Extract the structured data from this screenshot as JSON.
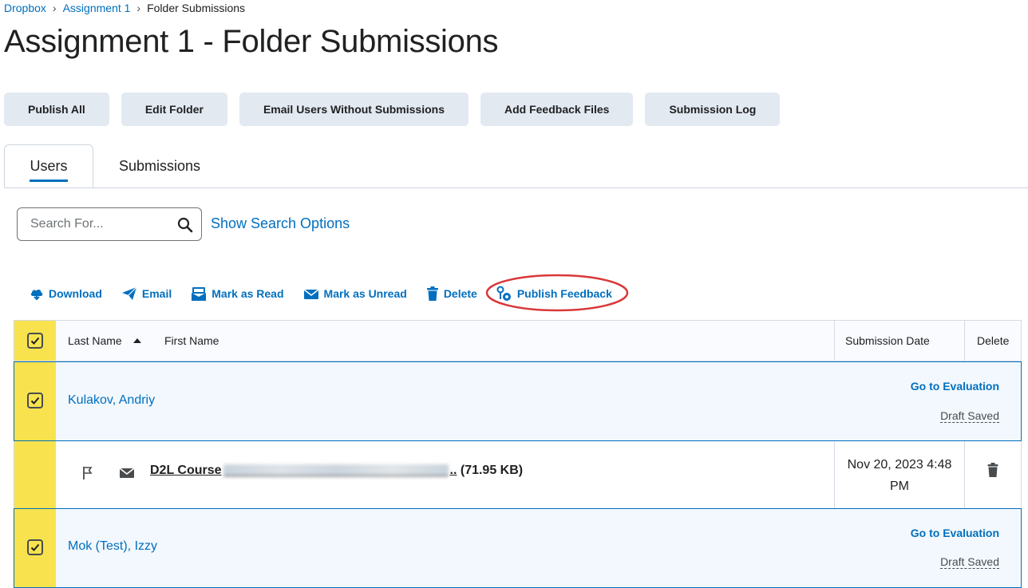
{
  "breadcrumb": {
    "items": [
      "Dropbox",
      "Assignment 1"
    ],
    "current": "Folder Submissions",
    "separator": "›"
  },
  "page": {
    "title": "Assignment 1 - Folder Submissions"
  },
  "toolbar": {
    "buttons": [
      "Publish All",
      "Edit Folder",
      "Email Users Without Submissions",
      "Add Feedback Files",
      "Submission Log"
    ]
  },
  "tabs": [
    {
      "label": "Users",
      "active": true
    },
    {
      "label": "Submissions",
      "active": false
    }
  ],
  "search": {
    "placeholder": "Search For...",
    "value": "",
    "options_link": "Show Search Options"
  },
  "actions": [
    {
      "label": "Download",
      "icon": "download-icon"
    },
    {
      "label": "Email",
      "icon": "send-icon"
    },
    {
      "label": "Mark as Read",
      "icon": "envelope-open-icon"
    },
    {
      "label": "Mark as Unread",
      "icon": "envelope-icon"
    },
    {
      "label": "Delete",
      "icon": "trash-icon"
    },
    {
      "label": "Publish Feedback",
      "icon": "publish-feedback-icon"
    }
  ],
  "table": {
    "columns": {
      "last_name": "Last Name",
      "first_name": "First Name",
      "submission_date": "Submission Date",
      "delete": "Delete"
    },
    "rows": [
      {
        "name": "Kulakov, Andriy",
        "go_to_evaluation": "Go to Evaluation",
        "status": "Draft Saved",
        "file": {
          "name_visible": "D2L Course",
          "ellipsis": "..",
          "size": "(71.95 KB)",
          "date_line1": "Nov 20, 2023 4:48",
          "date_line2": "PM"
        }
      },
      {
        "name": "Mok (Test), Izzy",
        "go_to_evaluation": "Go to Evaluation",
        "status": "Draft Saved"
      }
    ]
  },
  "colors": {
    "link": "#006fbf",
    "selected_column": "#f8e34e",
    "button_bg": "#e3e9f1",
    "annotation_circle": "#d9383a"
  }
}
